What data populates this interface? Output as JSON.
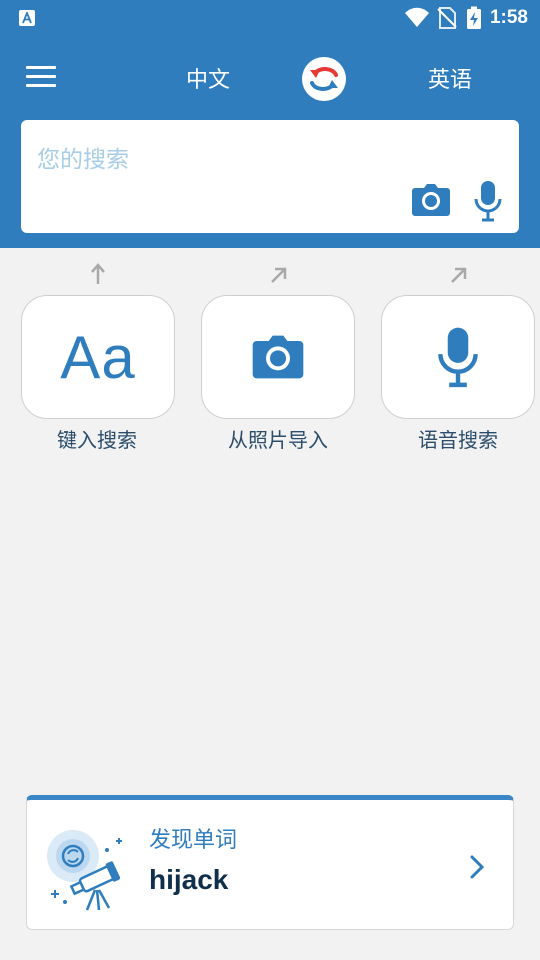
{
  "status_bar": {
    "time": "1:58",
    "icons": [
      "a-notification-icon",
      "wifi-icon",
      "no-sim-icon",
      "battery-charging-icon"
    ]
  },
  "app_bar": {
    "source_language": "中文",
    "target_language": "英语",
    "icons": [
      "menu-icon",
      "swap-languages-icon"
    ]
  },
  "search": {
    "placeholder": "您的搜索",
    "icons": [
      "camera-icon",
      "microphone-icon"
    ]
  },
  "actions": [
    {
      "label": "键入搜索",
      "icon": "aa-text-icon",
      "glyph": "Aa"
    },
    {
      "label": "从照片导入",
      "icon": "camera-icon"
    },
    {
      "label": "语音搜索",
      "icon": "microphone-icon"
    }
  ],
  "discover": {
    "title": "发现单词",
    "word": "hijack",
    "icons": [
      "telescope-illustration-icon",
      "chevron-right-icon"
    ]
  },
  "colors": {
    "primary": "#2f7dbd",
    "background": "#f2f2f2",
    "placeholder": "#a8cde6",
    "swap_red": "#e53935",
    "swap_blue": "#2f7dbd"
  }
}
